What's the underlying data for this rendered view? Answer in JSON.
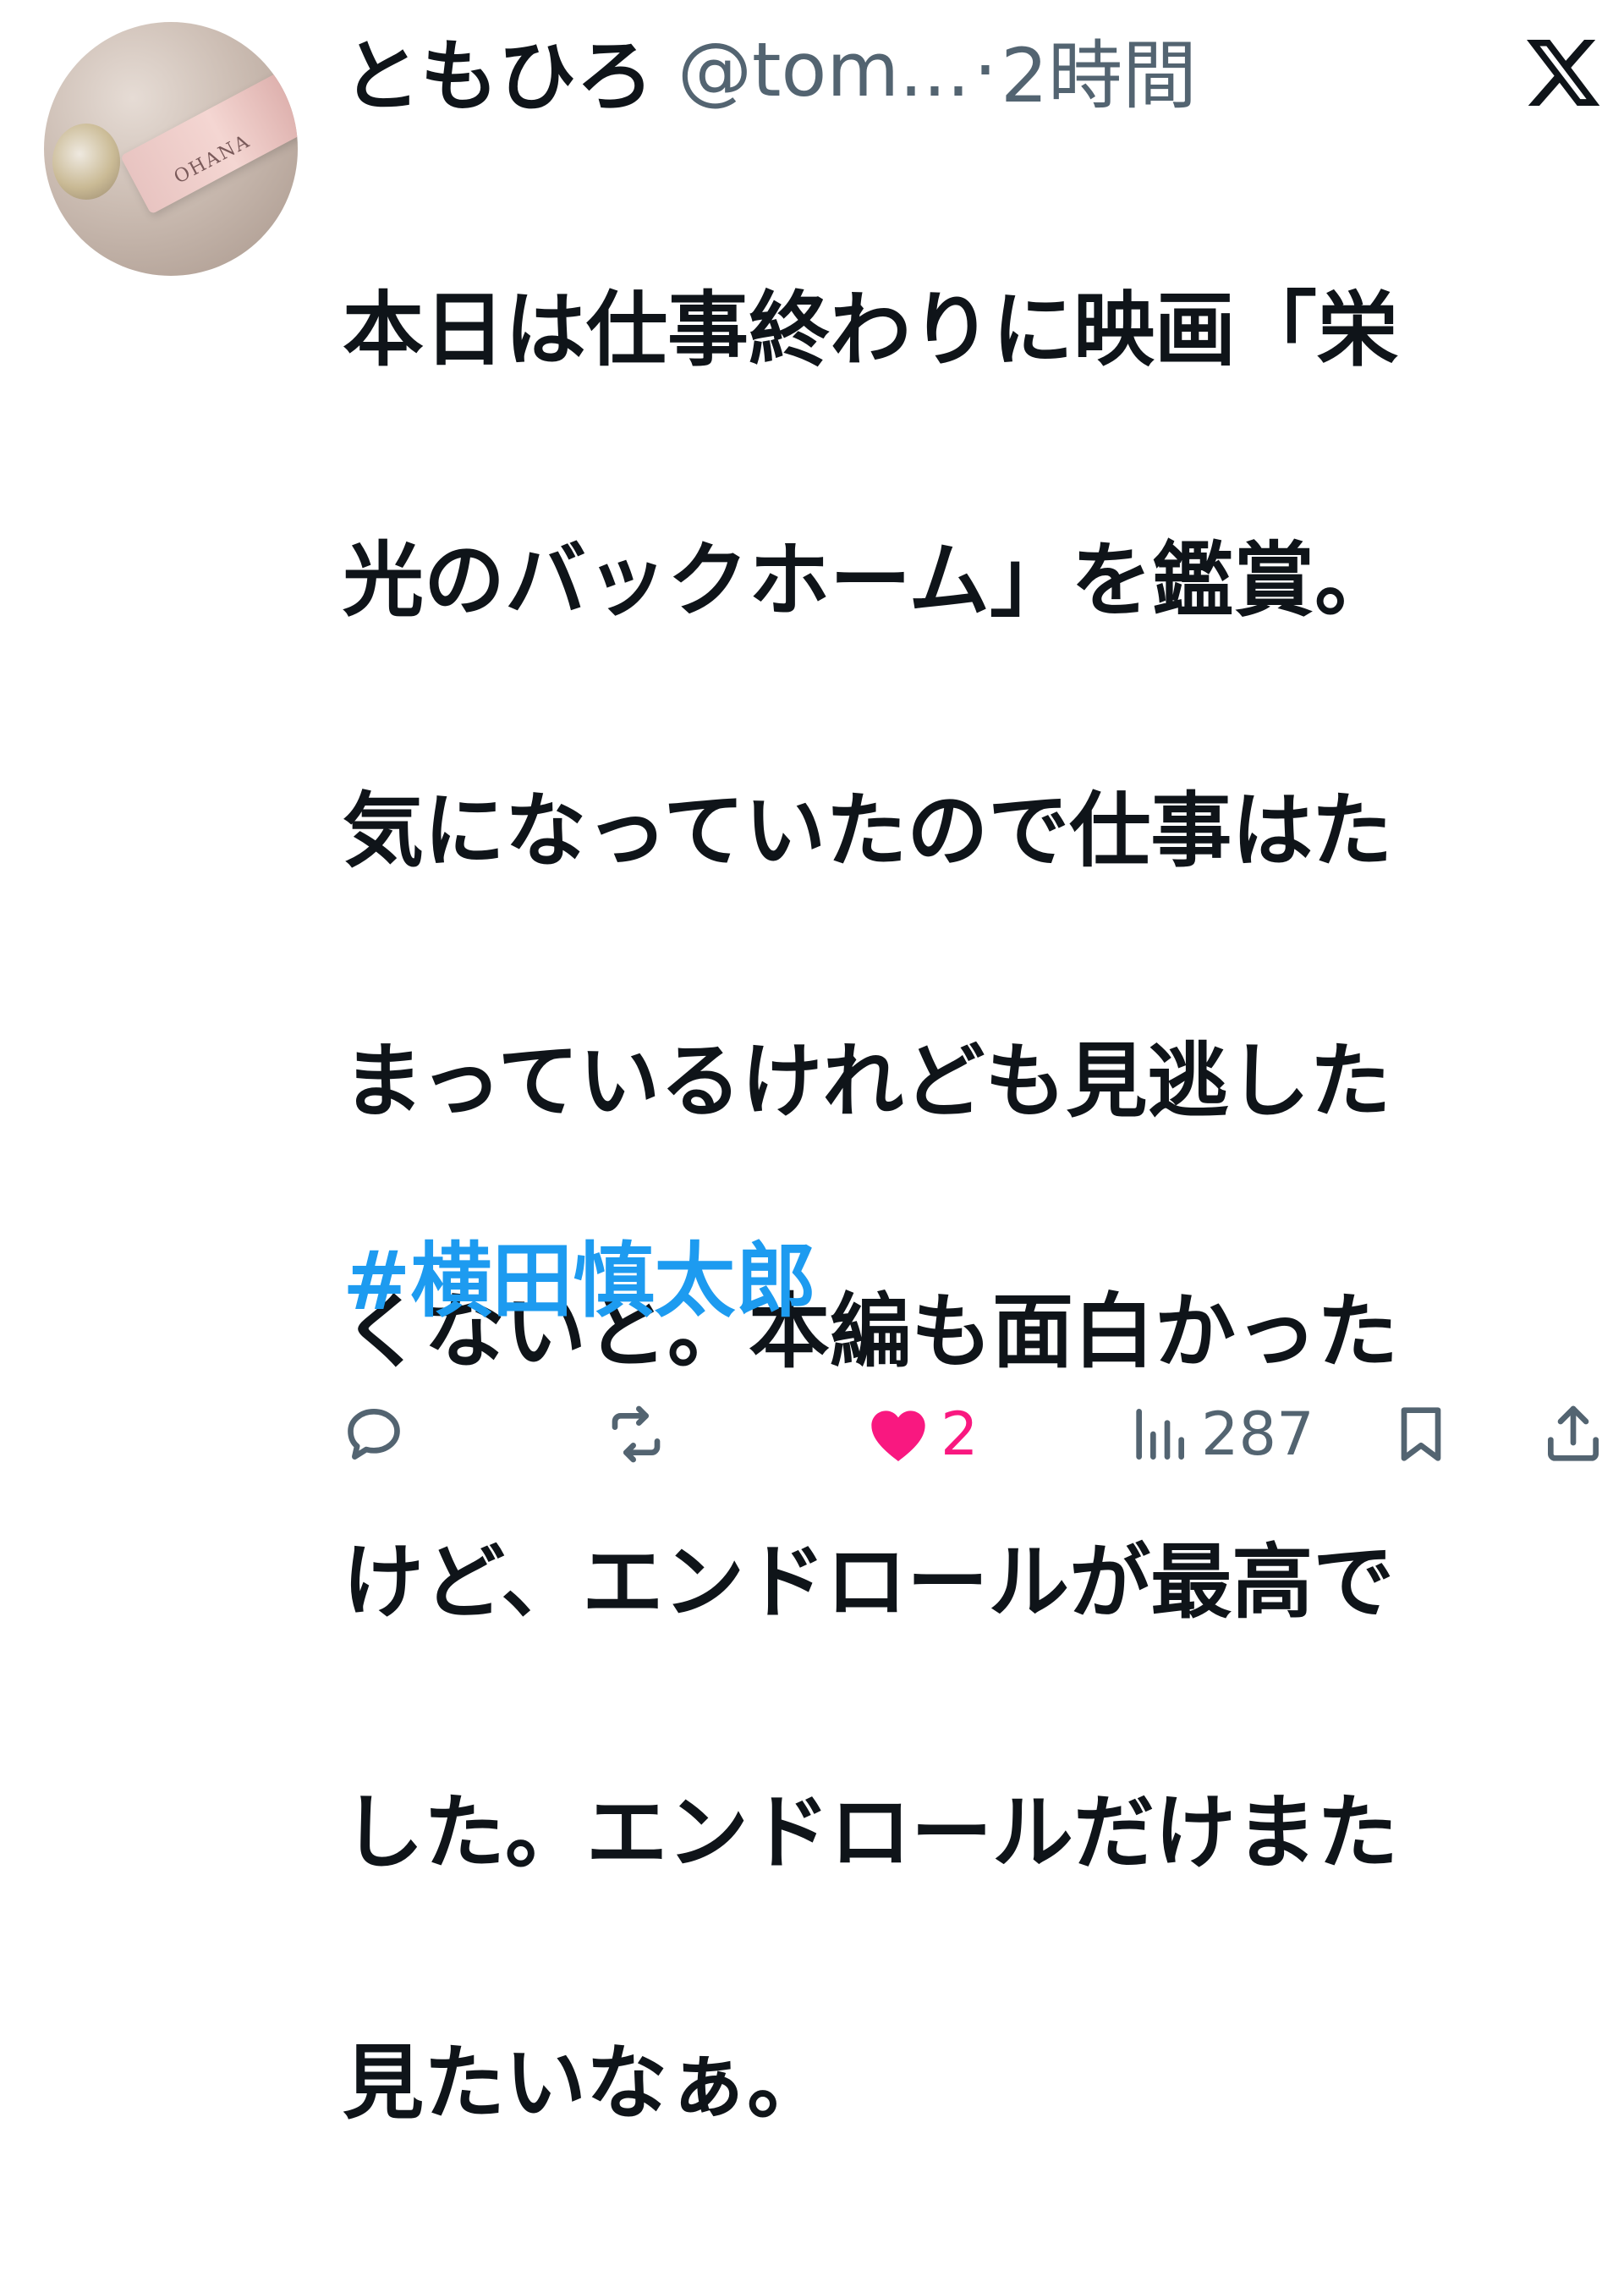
{
  "tweet": {
    "display_name": "ともひろ",
    "handle": "@tom...",
    "separator": "·",
    "time": "2時間",
    "avatar_text": "OHANA",
    "lines": [
      "本日は仕事終わりに映画「栄",
      "光のバックホーム」を鑑賞。",
      "気になっていたので仕事はた",
      "まっているけれども見逃した",
      "くないと。本編も面白かった",
      "けど、エンドロールが最高で",
      "した。エンドロールだけまた",
      "見たいなぁ。"
    ],
    "hashtag": "#横田慎太郎"
  },
  "actions": {
    "reply_count": "",
    "retweet_count": "",
    "like_count": "2",
    "views_count": "287"
  },
  "colors": {
    "text": "#0f1419",
    "muted": "#536471",
    "link": "#1d9bf0",
    "like": "#f91880"
  },
  "icons": {
    "logo": "x-logo-icon",
    "reply": "reply-icon",
    "retweet": "retweet-icon",
    "like": "heart-icon",
    "views": "views-icon",
    "bookmark": "bookmark-icon",
    "share": "share-icon"
  }
}
